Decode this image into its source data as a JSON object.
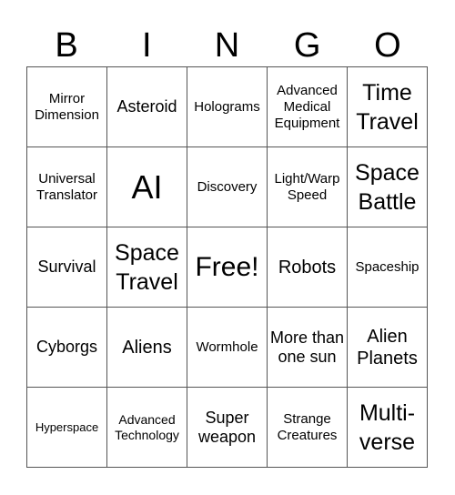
{
  "header": [
    "B",
    "I",
    "N",
    "G",
    "O"
  ],
  "cells": [
    {
      "text": "Mirror Dimension",
      "size": "s3"
    },
    {
      "text": "Asteroid",
      "size": "s4"
    },
    {
      "text": "Holograms",
      "size": "s3"
    },
    {
      "text": "Advanced Medical Equipment",
      "size": "s3"
    },
    {
      "text": "Time Travel",
      "size": "s6"
    },
    {
      "text": "Universal Translator",
      "size": "s3"
    },
    {
      "text": "AI",
      "size": "s8"
    },
    {
      "text": "Discovery",
      "size": "s3"
    },
    {
      "text": "Light/Warp Speed",
      "size": "s3"
    },
    {
      "text": "Space Battle",
      "size": "s6"
    },
    {
      "text": "Survival",
      "size": "s4"
    },
    {
      "text": "Space Travel",
      "size": "s6"
    },
    {
      "text": "Free!",
      "size": "s7"
    },
    {
      "text": "Robots",
      "size": "s5"
    },
    {
      "text": "Spaceship",
      "size": "s3"
    },
    {
      "text": "Cyborgs",
      "size": "s4"
    },
    {
      "text": "Aliens",
      "size": "s5"
    },
    {
      "text": "Wormhole",
      "size": "s3"
    },
    {
      "text": "More than one sun",
      "size": "s4"
    },
    {
      "text": "Alien Planets",
      "size": "s5"
    },
    {
      "text": "Hyperspace",
      "size": "s1"
    },
    {
      "text": "Advanced Technology",
      "size": "s2"
    },
    {
      "text": "Super weapon",
      "size": "s4"
    },
    {
      "text": "Strange Creatures",
      "size": "s3"
    },
    {
      "text": "Multi-verse",
      "size": "s6"
    }
  ]
}
